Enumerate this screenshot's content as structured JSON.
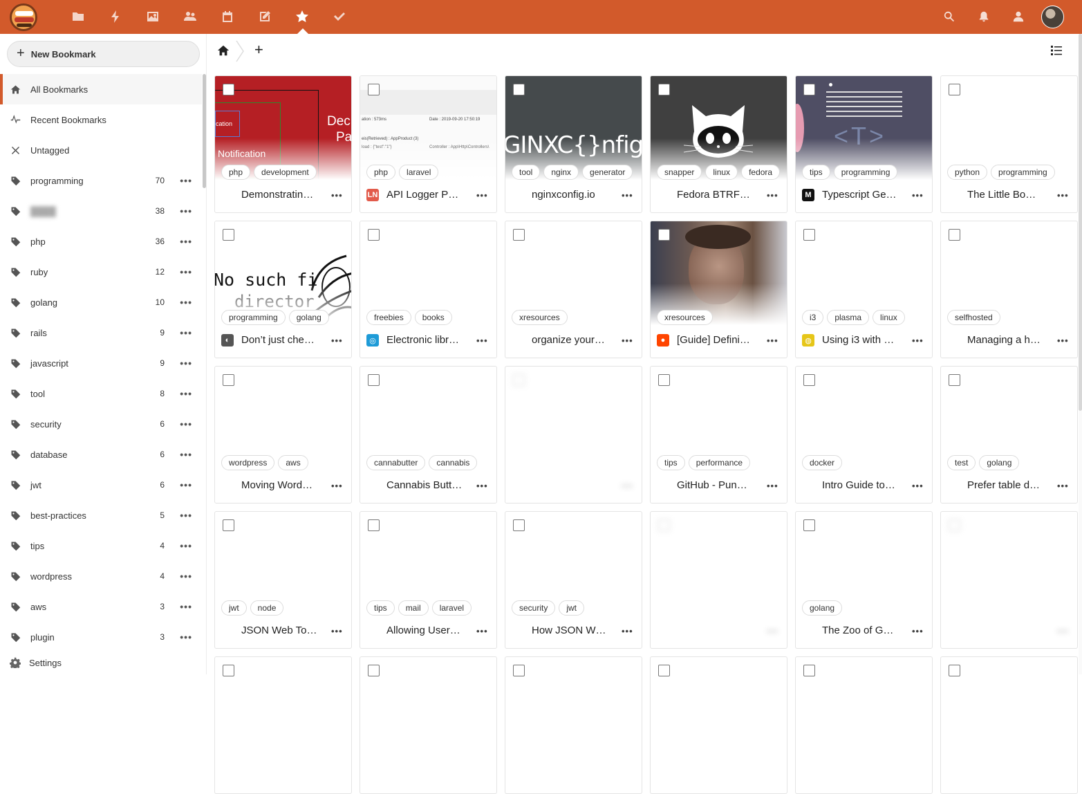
{
  "sidebar": {
    "new_bookmark": "New Bookmark",
    "nav": [
      {
        "label": "All Bookmarks",
        "icon": "home-icon",
        "active": true
      },
      {
        "label": "Recent Bookmarks",
        "icon": "activity-icon"
      },
      {
        "label": "Untagged",
        "icon": "close-icon"
      }
    ],
    "tags": [
      {
        "label": "programming",
        "count": "70"
      },
      {
        "label": "",
        "count": "38",
        "blurred": true
      },
      {
        "label": "php",
        "count": "36"
      },
      {
        "label": "ruby",
        "count": "12"
      },
      {
        "label": "golang",
        "count": "10"
      },
      {
        "label": "rails",
        "count": "9"
      },
      {
        "label": "javascript",
        "count": "9"
      },
      {
        "label": "tool",
        "count": "8"
      },
      {
        "label": "security",
        "count": "6"
      },
      {
        "label": "database",
        "count": "6"
      },
      {
        "label": "jwt",
        "count": "6"
      },
      {
        "label": "best-practices",
        "count": "5"
      },
      {
        "label": "tips",
        "count": "4"
      },
      {
        "label": "wordpress",
        "count": "4"
      },
      {
        "label": "aws",
        "count": "3"
      },
      {
        "label": "plugin",
        "count": "3"
      }
    ],
    "more_label": "•••",
    "settings": "Settings"
  },
  "toolbar": {
    "add": "+"
  },
  "header": {
    "accent": "#d25a2b",
    "active_app": "bookmarks"
  },
  "cards": [
    {
      "title": "Demonstratin…",
      "tags": [
        "php",
        "development"
      ],
      "thumb": "notification"
    },
    {
      "title": "API Logger P…",
      "tags": [
        "php",
        "laravel"
      ],
      "thumb": "logger",
      "favicon": "LN",
      "fav_color": "#e25b4b"
    },
    {
      "title": "nginxconfig.io",
      "tags": [
        "tool",
        "nginx",
        "generator"
      ],
      "thumb": "nginx"
    },
    {
      "title": "Fedora BTRF…",
      "tags": [
        "snapper",
        "linux",
        "fedora"
      ],
      "thumb": "github"
    },
    {
      "title": "Typescript Ge…",
      "tags": [
        "tips",
        "programming"
      ],
      "thumb": "typescript",
      "favicon": "M",
      "fav_color": "#111"
    },
    {
      "title": "The Little Bo…",
      "tags": [
        "python",
        "programming"
      ],
      "thumb": "none"
    },
    {
      "title": "Don’t just che…",
      "tags": [
        "programming",
        "golang"
      ],
      "thumb": "nosuch",
      "favicon": "◐",
      "fav_color": "#555"
    },
    {
      "title": "Electronic libr…",
      "tags": [
        "freebies",
        "books"
      ],
      "thumb": "none",
      "favicon": "◎",
      "fav_color": "#1e9bd7"
    },
    {
      "title": "organize your…",
      "tags": [
        "xresources"
      ],
      "thumb": "none"
    },
    {
      "title": "[Guide] Defini…",
      "tags": [
        "xresources"
      ],
      "thumb": "face",
      "favicon": "●",
      "fav_color": "#ff4500"
    },
    {
      "title": "Using i3 with …",
      "tags": [
        "i3",
        "plasma",
        "linux"
      ],
      "thumb": "none",
      "favicon": "◍",
      "fav_color": "#e6c619"
    },
    {
      "title": "Managing a h…",
      "tags": [
        "selfhosted"
      ],
      "thumb": "none"
    },
    {
      "title": "Moving Word…",
      "tags": [
        "wordpress",
        "aws"
      ],
      "thumb": "none"
    },
    {
      "title": "Cannabis Butt…",
      "tags": [
        "cannabutter",
        "cannabis"
      ],
      "thumb": "none"
    },
    {
      "title": "",
      "tags": [],
      "thumb": "none",
      "loading": true
    },
    {
      "title": "GitHub - Pun…",
      "tags": [
        "tips",
        "performance"
      ],
      "thumb": "none"
    },
    {
      "title": "Intro Guide to…",
      "tags": [
        "docker"
      ],
      "thumb": "none"
    },
    {
      "title": "Prefer table d…",
      "tags": [
        "test",
        "golang"
      ],
      "thumb": "none"
    },
    {
      "title": "JSON Web To…",
      "tags": [
        "jwt",
        "node"
      ],
      "thumb": "none"
    },
    {
      "title": "Allowing User…",
      "tags": [
        "tips",
        "mail",
        "laravel"
      ],
      "thumb": "none"
    },
    {
      "title": "How JSON W…",
      "tags": [
        "security",
        "jwt"
      ],
      "thumb": "none"
    },
    {
      "title": "",
      "tags": [],
      "thumb": "none",
      "loading": true
    },
    {
      "title": "The Zoo of G…",
      "tags": [
        "golang"
      ],
      "thumb": "none"
    },
    {
      "title": "",
      "tags": [],
      "thumb": "none",
      "loading": true
    },
    {
      "title": "",
      "tags": [],
      "thumb": "none"
    },
    {
      "title": "",
      "tags": [],
      "thumb": "none"
    },
    {
      "title": "",
      "tags": [],
      "thumb": "none"
    },
    {
      "title": "",
      "tags": [],
      "thumb": "none"
    },
    {
      "title": "",
      "tags": [],
      "thumb": "none"
    },
    {
      "title": "",
      "tags": [],
      "thumb": "none"
    }
  ],
  "thumb_text": {
    "notification_a": "Notification",
    "notification_b": "Dec",
    "notification_c": "Pa",
    "notification_d": "cation",
    "nginx": "GINXC{}nfig",
    "nosuch_a": "No such fi",
    "nosuch_b": "director",
    "logger_a": "ation : 573ms",
    "logger_b": "Date : 2019-09-20 17:50:19",
    "logger_c": "eis(Retrieved) : AppProduct (3)",
    "logger_d": "load : {\"test\":\"1\"}",
    "logger_e": "Controller : App\\Http\\Controllers\\",
    "ts": "<T>"
  },
  "dots_label": "•••"
}
